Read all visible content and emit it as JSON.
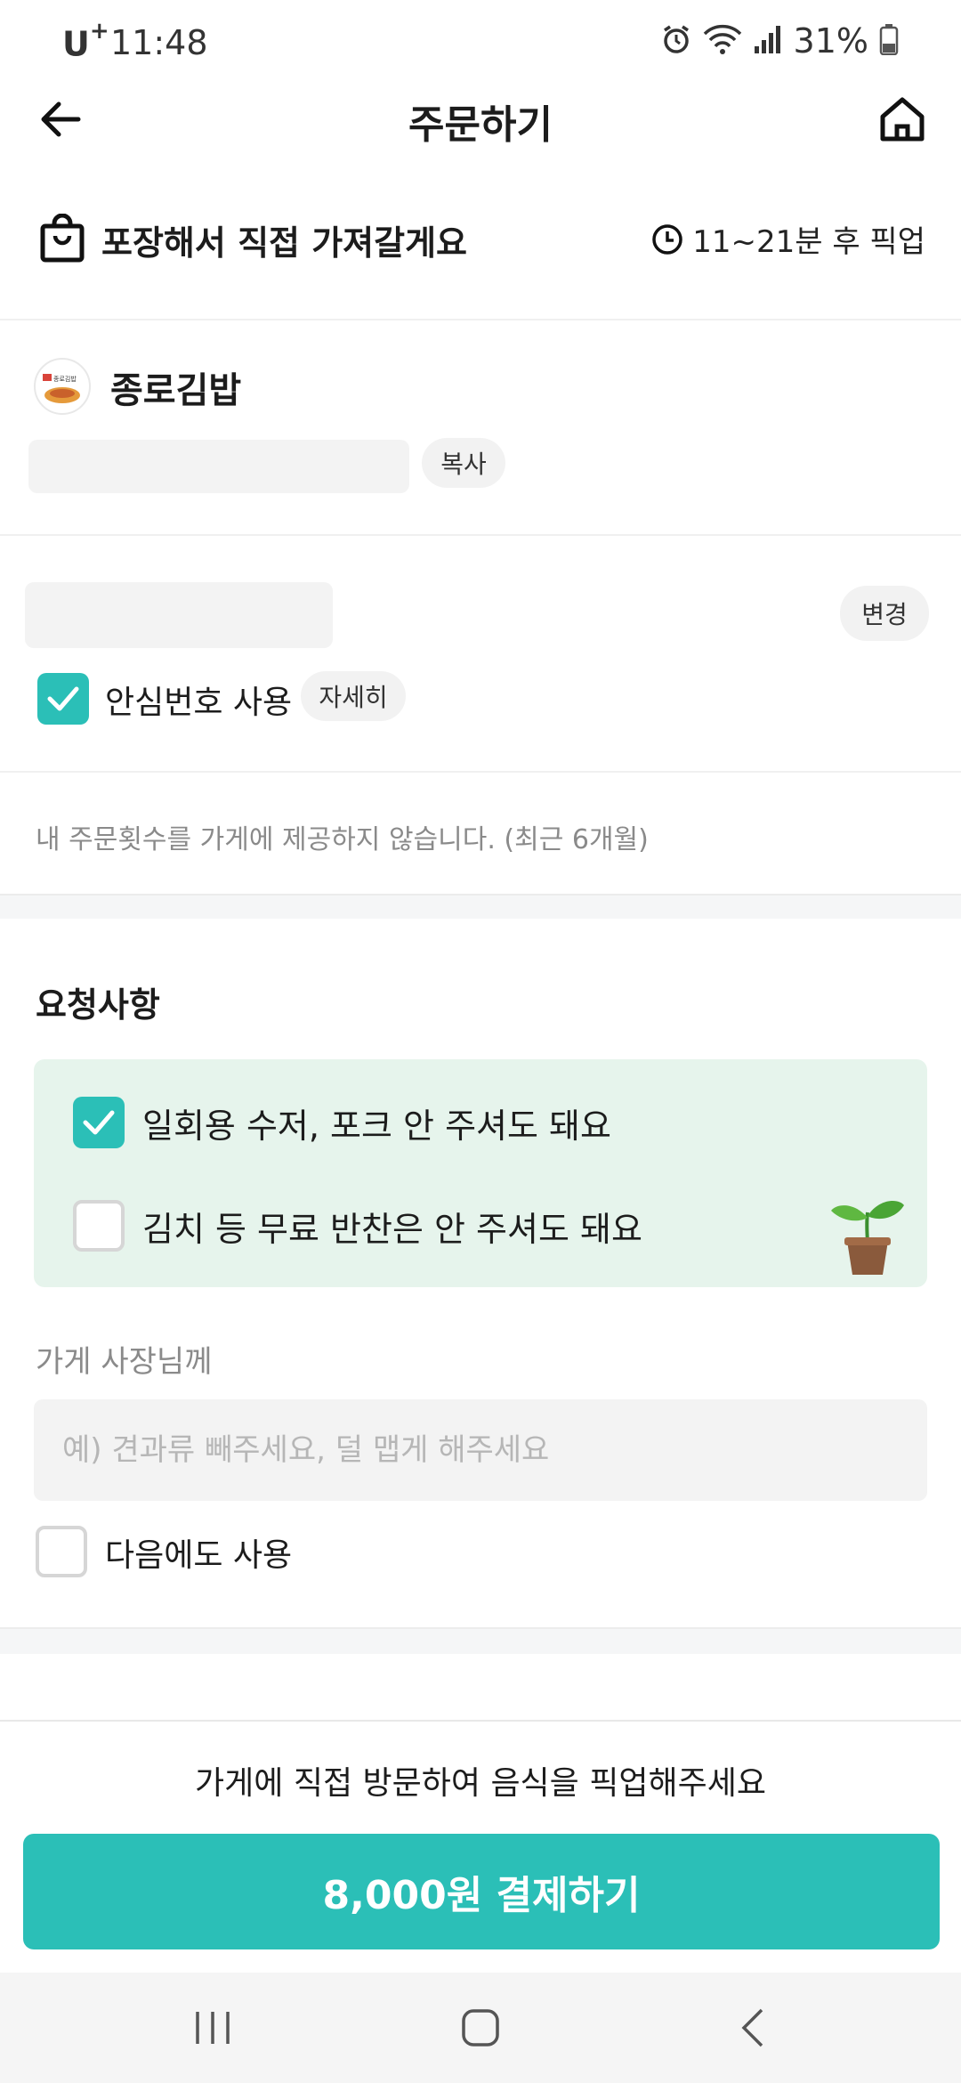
{
  "status_bar": {
    "carrier": "U",
    "carrier_plus": "+",
    "time": "11:48",
    "battery_percent": "31%"
  },
  "header": {
    "title": "주문하기"
  },
  "pickup": {
    "label": "포장해서 직접 가져갈게요",
    "time": "11~21분 후 픽업"
  },
  "store": {
    "name": "종로김밥",
    "logo_text": "종로김밥",
    "copy_label": "복사"
  },
  "contact": {
    "change_label": "변경",
    "safe_number_label": "안심번호 사용",
    "safe_number_checked": true,
    "detail_label": "자세히"
  },
  "order_count_notice": "내 주문횟수를 가게에 제공하지 않습니다. (최근 6개월)",
  "requests": {
    "title": "요청사항",
    "options": [
      {
        "label": "일회용 수저, 포크 안 주셔도 돼요",
        "checked": true
      },
      {
        "label": "김치 등 무료 반찬은 안 주셔도 돼요",
        "checked": false
      }
    ],
    "owner_label": "가게 사장님께",
    "owner_input_value": "",
    "owner_placeholder": "예) 견과류 빼주세요, 덜 맵게 해주세요",
    "reuse_label": "다음에도 사용",
    "reuse_checked": false
  },
  "bottom": {
    "notice": "가게에 직접 방문하여 음식을 픽업해주세요",
    "pay_button": "8,000원 결제하기"
  },
  "colors": {
    "accent": "#2bbfb7",
    "green_box_bg": "#e6f4ec",
    "muted_text": "#8a8a8a"
  },
  "icons": {
    "back": "arrow-left-icon",
    "home": "home-icon",
    "bag": "shopping-bag-icon",
    "clock": "clock-icon",
    "plant": "sprout-icon",
    "nav_recents": "recents-icon",
    "nav_home": "nav-home-icon",
    "nav_back": "nav-back-icon"
  }
}
